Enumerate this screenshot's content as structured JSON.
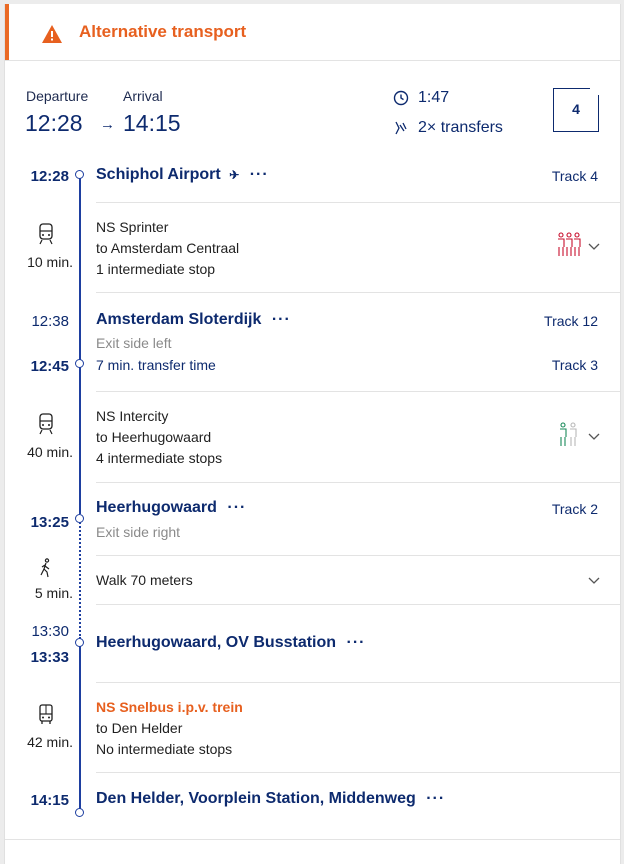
{
  "alert": {
    "text": "Alternative transport",
    "icon": "warning-icon",
    "color": "#e7601f"
  },
  "summary": {
    "departure_label": "Departure",
    "arrival_label": "Arrival",
    "departure_time": "12:28",
    "arrival_time": "14:15",
    "arrow": "→",
    "duration": "1:47",
    "transfers": "2× transfers",
    "platform_badge": "4"
  },
  "stops": [
    {
      "time_arr": "",
      "time_dep": "12:28",
      "name": "Schiphol Airport",
      "extra_icon": "plane-icon",
      "track": "Track 4",
      "note": ""
    },
    {
      "time_arr": "12:38",
      "time_dep": "12:45",
      "name": "Amsterdam Sloterdijk",
      "track_arr": "Track 12",
      "track": "Track 3",
      "note": "Exit side left",
      "transfer": "7 min. transfer time"
    },
    {
      "time_arr": "",
      "time_dep": "13:25",
      "name": "Heerhugowaard",
      "track": "Track 2",
      "note": "Exit side right"
    },
    {
      "time_arr": "13:30",
      "time_dep": "13:33",
      "name": "Heerhugowaard, OV Busstation"
    },
    {
      "time_arr": "",
      "time_dep": "14:15",
      "name": "Den Helder, Voorplein Station, Middenweg"
    }
  ],
  "legs": [
    {
      "mode": "train",
      "duration": "10 min.",
      "service": "NS Sprinter",
      "direction": "to Amsterdam Centraal",
      "stops": "1 intermediate stop",
      "crowd_color": "#c8102e"
    },
    {
      "mode": "train",
      "duration": "40 min.",
      "service": "NS Intercity",
      "direction": "to Heerhugowaard",
      "stops": "4 intermediate stops",
      "crowd_color": "#1a8a5a"
    },
    {
      "mode": "walk",
      "duration": "5 min.",
      "service": "Walk 70 meters"
    },
    {
      "mode": "bus",
      "duration": "42 min.",
      "service": "NS Snelbus i.p.v. trein",
      "direction": "to Den Helder",
      "stops": "No intermediate stops"
    }
  ],
  "more": "···"
}
